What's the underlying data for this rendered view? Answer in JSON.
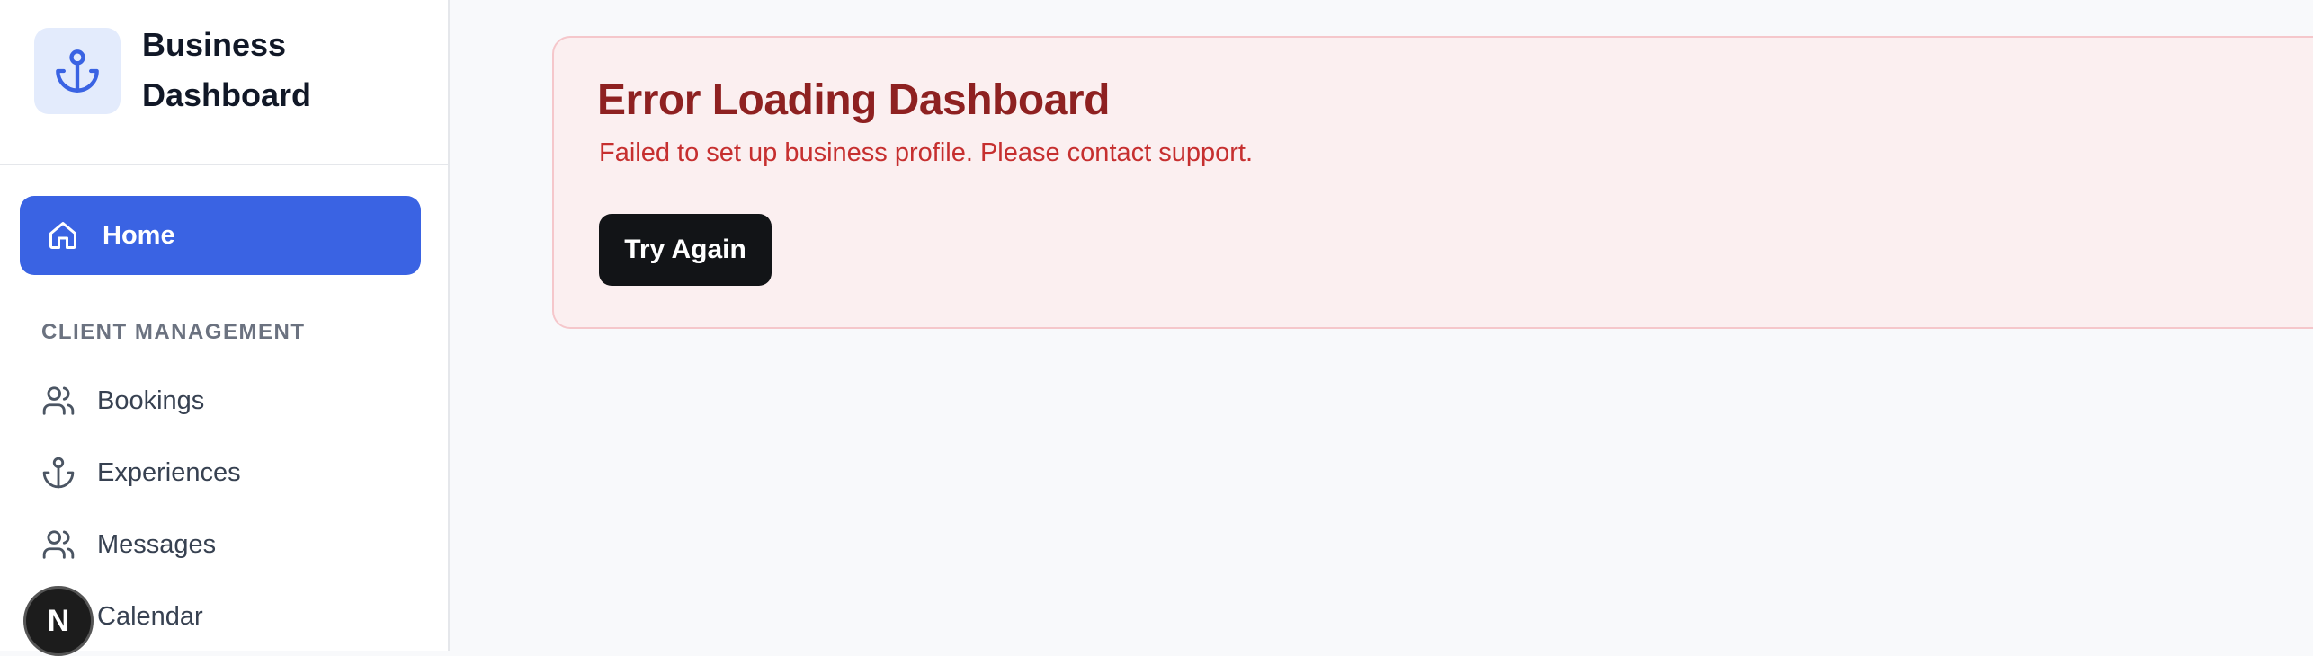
{
  "brand": {
    "title": "Business Dashboard",
    "logo_icon": "anchor-icon",
    "accent_color": "#3a63e3"
  },
  "sidebar": {
    "home": {
      "label": "Home",
      "icon": "home-icon",
      "active": true
    },
    "section_title": "CLIENT MANAGEMENT",
    "items": [
      {
        "label": "Bookings",
        "icon": "users-icon"
      },
      {
        "label": "Experiences",
        "icon": "anchor-icon"
      },
      {
        "label": "Messages",
        "icon": "users-icon"
      },
      {
        "label": "Calendar",
        "icon": "calendar-icon"
      }
    ]
  },
  "dev_badge": {
    "letter": "N"
  },
  "error": {
    "title": "Error Loading Dashboard",
    "message": "Failed to set up business profile. Please contact support.",
    "button_label": "Try Again",
    "background_color": "#fbeff0",
    "title_color": "#8e2121",
    "message_color": "#c62f2f"
  }
}
